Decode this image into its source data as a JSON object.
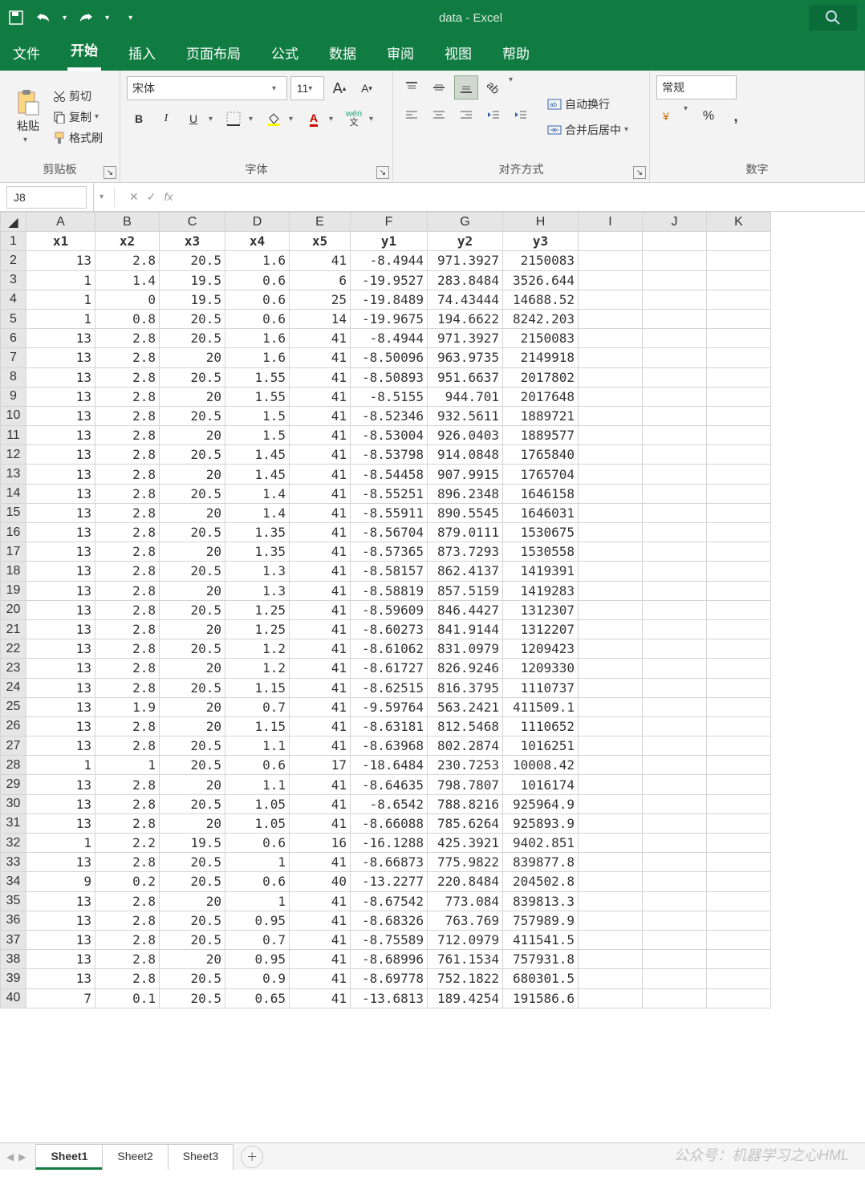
{
  "window": {
    "title": "data - Excel"
  },
  "qat": {
    "save": "保存",
    "undo": "撤销",
    "redo": "重做"
  },
  "tabs": {
    "file": "文件",
    "home": "开始",
    "insert": "插入",
    "layout": "页面布局",
    "formulas": "公式",
    "data": "数据",
    "review": "审阅",
    "view": "视图",
    "help": "帮助",
    "active": "home"
  },
  "ribbon": {
    "clipboard": {
      "label": "剪贴板",
      "paste": "粘贴",
      "cut": "剪切",
      "copy": "复制",
      "fmtpaint": "格式刷"
    },
    "font": {
      "label": "字体",
      "name": "宋体",
      "size": "11"
    },
    "align": {
      "label": "对齐方式",
      "wrap": "自动换行",
      "merge": "合并后居中"
    },
    "number": {
      "label": "数字",
      "format": "常规"
    },
    "wen": "wén"
  },
  "formula_bar": {
    "namebox": "J8",
    "fx_label": "fx",
    "value": ""
  },
  "sheets": {
    "tabs": [
      "Sheet1",
      "Sheet2",
      "Sheet3"
    ],
    "active": 0
  },
  "watermark": "公众号：机器学习之心HML",
  "columns": [
    "A",
    "B",
    "C",
    "D",
    "E",
    "F",
    "G",
    "H",
    "I",
    "J",
    "K"
  ],
  "headers": [
    "x1",
    "x2",
    "x3",
    "x4",
    "x5",
    "y1",
    "y2",
    "y3"
  ],
  "chart_data": {
    "type": "table",
    "columns": [
      "x1",
      "x2",
      "x3",
      "x4",
      "x5",
      "y1",
      "y2",
      "y3"
    ],
    "rows": [
      [
        13,
        2.8,
        20.5,
        1.6,
        41,
        -8.4944,
        971.3927,
        2150083
      ],
      [
        1,
        1.4,
        19.5,
        0.6,
        6,
        -19.9527,
        283.8484,
        3526.644
      ],
      [
        1,
        0,
        19.5,
        0.6,
        25,
        -19.8489,
        74.43444,
        14688.52
      ],
      [
        1,
        0.8,
        20.5,
        0.6,
        14,
        -19.9675,
        194.6622,
        8242.203
      ],
      [
        13,
        2.8,
        20.5,
        1.6,
        41,
        -8.4944,
        971.3927,
        2150083
      ],
      [
        13,
        2.8,
        20,
        1.6,
        41,
        -8.50096,
        963.9735,
        2149918
      ],
      [
        13,
        2.8,
        20.5,
        1.55,
        41,
        -8.50893,
        951.6637,
        2017802
      ],
      [
        13,
        2.8,
        20,
        1.55,
        41,
        -8.5155,
        944.701,
        2017648
      ],
      [
        13,
        2.8,
        20.5,
        1.5,
        41,
        -8.52346,
        932.5611,
        1889721
      ],
      [
        13,
        2.8,
        20,
        1.5,
        41,
        -8.53004,
        926.0403,
        1889577
      ],
      [
        13,
        2.8,
        20.5,
        1.45,
        41,
        -8.53798,
        914.0848,
        1765840
      ],
      [
        13,
        2.8,
        20,
        1.45,
        41,
        -8.54458,
        907.9915,
        1765704
      ],
      [
        13,
        2.8,
        20.5,
        1.4,
        41,
        -8.55251,
        896.2348,
        1646158
      ],
      [
        13,
        2.8,
        20,
        1.4,
        41,
        -8.55911,
        890.5545,
        1646031
      ],
      [
        13,
        2.8,
        20.5,
        1.35,
        41,
        -8.56704,
        879.0111,
        1530675
      ],
      [
        13,
        2.8,
        20,
        1.35,
        41,
        -8.57365,
        873.7293,
        1530558
      ],
      [
        13,
        2.8,
        20.5,
        1.3,
        41,
        -8.58157,
        862.4137,
        1419391
      ],
      [
        13,
        2.8,
        20,
        1.3,
        41,
        -8.58819,
        857.5159,
        1419283
      ],
      [
        13,
        2.8,
        20.5,
        1.25,
        41,
        -8.59609,
        846.4427,
        1312307
      ],
      [
        13,
        2.8,
        20,
        1.25,
        41,
        -8.60273,
        841.9144,
        1312207
      ],
      [
        13,
        2.8,
        20.5,
        1.2,
        41,
        -8.61062,
        831.0979,
        1209423
      ],
      [
        13,
        2.8,
        20,
        1.2,
        41,
        -8.61727,
        826.9246,
        1209330
      ],
      [
        13,
        2.8,
        20.5,
        1.15,
        41,
        -8.62515,
        816.3795,
        1110737
      ],
      [
        13,
        1.9,
        20,
        0.7,
        41,
        -9.59764,
        563.2421,
        411509.1
      ],
      [
        13,
        2.8,
        20,
        1.15,
        41,
        -8.63181,
        812.5468,
        1110652
      ],
      [
        13,
        2.8,
        20.5,
        1.1,
        41,
        -8.63968,
        802.2874,
        1016251
      ],
      [
        1,
        1,
        20.5,
        0.6,
        17,
        -18.6484,
        230.7253,
        10008.42
      ],
      [
        13,
        2.8,
        20,
        1.1,
        41,
        -8.64635,
        798.7807,
        1016174
      ],
      [
        13,
        2.8,
        20.5,
        1.05,
        41,
        -8.6542,
        788.8216,
        925964.9
      ],
      [
        13,
        2.8,
        20,
        1.05,
        41,
        -8.66088,
        785.6264,
        925893.9
      ],
      [
        1,
        2.2,
        19.5,
        0.6,
        16,
        -16.1288,
        425.3921,
        9402.851
      ],
      [
        13,
        2.8,
        20.5,
        1,
        41,
        -8.66873,
        775.9822,
        839877.8
      ],
      [
        9,
        0.2,
        20.5,
        0.6,
        40,
        -13.2277,
        220.8484,
        204502.8
      ],
      [
        13,
        2.8,
        20,
        1,
        41,
        -8.67542,
        773.084,
        839813.3
      ],
      [
        13,
        2.8,
        20.5,
        0.95,
        41,
        -8.68326,
        763.769,
        757989.9
      ],
      [
        13,
        2.8,
        20.5,
        0.7,
        41,
        -8.75589,
        712.0979,
        411541.5
      ],
      [
        13,
        2.8,
        20,
        0.95,
        41,
        -8.68996,
        761.1534,
        757931.8
      ],
      [
        13,
        2.8,
        20.5,
        0.9,
        41,
        -8.69778,
        752.1822,
        680301.5
      ],
      [
        7,
        0.1,
        20.5,
        0.65,
        41,
        -13.6813,
        189.4254,
        191586.6
      ]
    ]
  }
}
